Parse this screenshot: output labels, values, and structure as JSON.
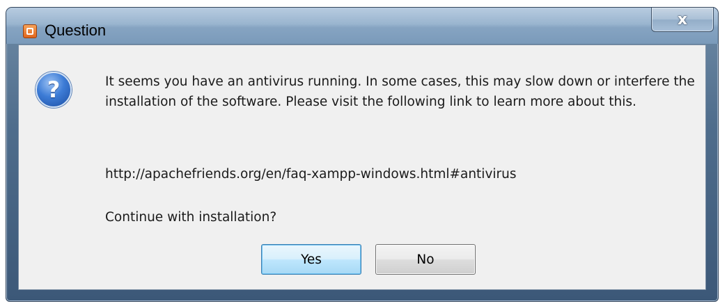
{
  "window": {
    "title": "Question",
    "close_glyph": "x",
    "app_icon": "xampp-app-icon"
  },
  "dialog": {
    "icon": "question-icon",
    "message": "It seems you have an antivirus running. In some cases, this may slow down or interfere the installation of the software. Please visit the following link to learn more about this.",
    "link": "http://apachefriends.org/en/faq-xampp-windows.html#antivirus",
    "prompt": "Continue with installation?",
    "question_glyph": "?"
  },
  "buttons": {
    "yes": "Yes",
    "no": "No"
  },
  "colors": {
    "default_button_border": "#3c7fb1",
    "client_background": "#f0f0f0",
    "app_icon": "#e0651c",
    "question_icon": "#3d7cd6"
  }
}
